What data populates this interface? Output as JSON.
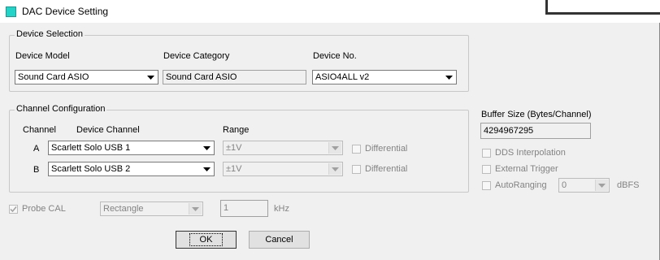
{
  "window": {
    "title": "DAC Device Setting"
  },
  "device_selection": {
    "legend": "Device Selection",
    "model_label": "Device Model",
    "model_value": "Sound Card ASIO",
    "category_label": "Device Category",
    "category_value": "Sound Card ASIO",
    "number_label": "Device No.",
    "number_value": "ASIO4ALL v2"
  },
  "channel_config": {
    "legend": "Channel Configuration",
    "channel_header": "Channel",
    "device_channel_header": "Device Channel",
    "range_header": "Range",
    "rows": [
      {
        "channel": "A",
        "device_channel": "Scarlett Solo USB 1",
        "range": "±1V",
        "differential_label": "Differential"
      },
      {
        "channel": "B",
        "device_channel": "Scarlett Solo USB 2",
        "range": "±1V",
        "differential_label": "Differential"
      }
    ]
  },
  "buffer": {
    "label": "Buffer Size (Bytes/Channel)",
    "value": "4294967295"
  },
  "options": {
    "dds_label": "DDS Interpolation",
    "external_trigger_label": "External Trigger",
    "autoranging_label": "AutoRanging",
    "autoranging_value": "0",
    "autoranging_unit": "dBFS"
  },
  "probe": {
    "label": "Probe CAL",
    "checked": true,
    "waveform_value": "Rectangle",
    "frequency_value": "1",
    "frequency_unit": "kHz"
  },
  "buttons": {
    "ok": "OK",
    "cancel": "Cancel"
  }
}
